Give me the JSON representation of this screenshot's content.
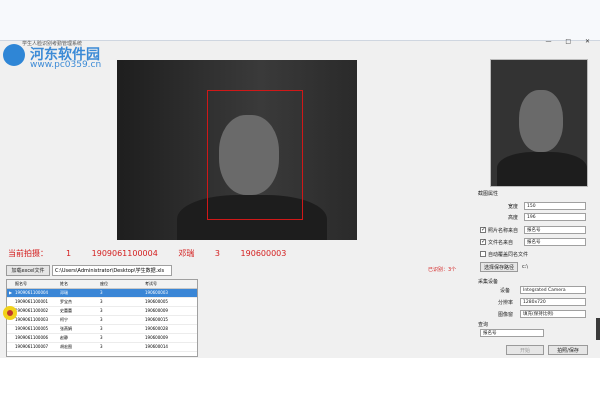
{
  "window": {
    "title": "学生人脸识别考勤管理系统",
    "controls": "— □ ✕"
  },
  "watermark": {
    "title": "河东软件园",
    "url": "www.pc0359.cn"
  },
  "info_line": {
    "label": "当前拍摄：",
    "count": "1",
    "current_id": "1909061100004",
    "matched_name": "邓瑞",
    "index": "3",
    "exam_id": "190600003"
  },
  "toolbar": {
    "load_button": "加载excel文件",
    "file_path": "C:\\Users\\Administrator\\Desktop\\学生数据.xls",
    "status": "已识别：3个"
  },
  "table": {
    "headers": [
      "",
      "报名号",
      "姓名",
      "座位",
      "考试号"
    ],
    "rows": [
      {
        "marker": "▶",
        "reg": "1909061100004",
        "name": "邓瑞",
        "seat": "3",
        "exam": "190600003",
        "selected": true
      },
      {
        "marker": "",
        "reg": "1909061100001",
        "name": "罗宝杰",
        "seat": "3",
        "exam": "190600005",
        "selected": false
      },
      {
        "marker": "",
        "reg": "1909061100002",
        "name": "史蕾蕾",
        "seat": "3",
        "exam": "190600009",
        "selected": false
      },
      {
        "marker": "",
        "reg": "1909061100003",
        "name": "柯宁",
        "seat": "3",
        "exam": "190600015",
        "selected": false
      },
      {
        "marker": "",
        "reg": "1909061100005",
        "name": "张燕娟",
        "seat": "3",
        "exam": "190600028",
        "selected": false
      },
      {
        "marker": "",
        "reg": "1909061100006",
        "name": "赵静",
        "seat": "3",
        "exam": "190600009",
        "selected": false
      },
      {
        "marker": "",
        "reg": "1909061100007",
        "name": "胡宏图",
        "seat": "3",
        "exam": "190600014",
        "selected": false
      }
    ]
  },
  "panel": {
    "section_title": "截图属性",
    "width_label": "宽度",
    "width_value": "150",
    "height_label": "高度",
    "height_value": "196",
    "photo_name_label": "照片名称来自",
    "photo_name_value": "报名号",
    "file_name_label": "文件名来自",
    "file_name_value": "报名号",
    "auto_save_label": "自动覆盖同名文件",
    "save_dir_button": "选择保存路径",
    "save_dir_value": "c:\\",
    "capture_section": "采集设备",
    "device_label": "设备",
    "device_value": "Integrated Camera",
    "resolution_label": "分辨率",
    "resolution_value": "1280x720",
    "display_label": "图像窗",
    "display_value": "填充(保持比例)",
    "query_section": "查询",
    "query_field_value": "报名号",
    "start_button": "开始",
    "stop_button": "拍照/保存"
  },
  "colors": {
    "selected_row": "#3a86d6",
    "info_red": "#d42020",
    "watermark_blue": "#3b8ad6"
  }
}
